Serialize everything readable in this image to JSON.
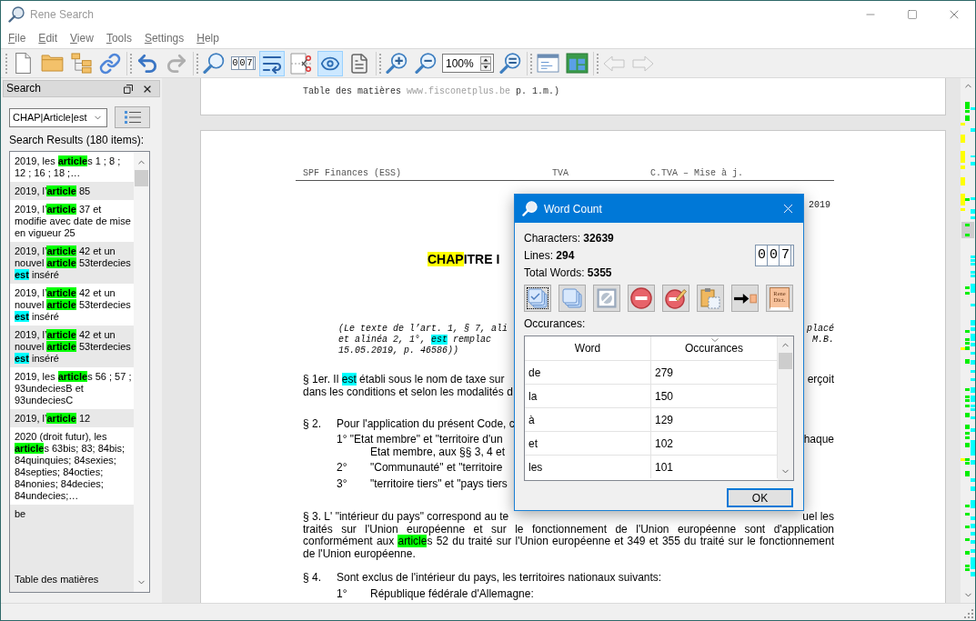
{
  "window": {
    "title": "Rene Search"
  },
  "menu": [
    {
      "label": "File"
    },
    {
      "label": "Edit"
    },
    {
      "label": "View"
    },
    {
      "label": "Tools"
    },
    {
      "label": "Settings"
    },
    {
      "label": "Help"
    }
  ],
  "toolbar": [
    [
      {
        "kind": "button",
        "on": false,
        "disabled": false
      },
      {
        "kind": "button",
        "on": false,
        "disabled": false
      },
      {
        "kind": "button",
        "on": false,
        "disabled": false
      },
      {
        "kind": "button",
        "on": false,
        "disabled": false
      }
    ],
    [
      {
        "kind": "button",
        "on": false,
        "disabled": false
      },
      {
        "kind": "button",
        "on": false,
        "disabled": true
      }
    ],
    [
      {
        "kind": "button",
        "on": false,
        "disabled": false
      },
      {
        "kind": "counter",
        "label": "007",
        "on": false,
        "disabled": false
      },
      {
        "kind": "button",
        "on": true,
        "disabled": false
      },
      {
        "kind": "button",
        "on": false,
        "disabled": false
      },
      {
        "kind": "button",
        "on": true,
        "disabled": false
      },
      {
        "kind": "button",
        "on": false,
        "disabled": false
      }
    ],
    [
      {
        "kind": "button",
        "on": false,
        "disabled": false
      },
      {
        "kind": "button",
        "on": false,
        "disabled": false
      },
      {
        "kind": "zoom",
        "value": "100%"
      },
      {
        "kind": "button",
        "on": false,
        "disabled": false
      }
    ],
    [
      {
        "kind": "button",
        "on": false,
        "disabled": false
      },
      {
        "kind": "button",
        "on": false,
        "disabled": false
      }
    ],
    [
      {
        "kind": "button",
        "on": false,
        "disabled": true
      },
      {
        "kind": "button",
        "on": false,
        "disabled": true
      }
    ]
  ],
  "search_panel": {
    "title": "Search",
    "query": "CHAP|Article|est",
    "results_label": "Search Results (180 items):",
    "results": [
      {
        "parts": [
          {
            "text": "2019, les "
          },
          {
            "text": "article",
            "color": "#00ff00"
          },
          {
            "text": "s 1 ; 8 ; 12 ; 16 ; 18 ;…"
          }
        ]
      },
      {
        "parts": [
          {
            "text": "2019, l’"
          },
          {
            "text": "article",
            "color": "#00ff00"
          },
          {
            "text": " 85"
          }
        ]
      },
      {
        "parts": [
          {
            "text": "2019, l’"
          },
          {
            "text": "article",
            "color": "#00ff00"
          },
          {
            "text": " 37 et modifie avec date de mise en vigueur 25"
          }
        ]
      },
      {
        "parts": [
          {
            "text": "2019, l’"
          },
          {
            "text": "article",
            "color": "#00ff00"
          },
          {
            "text": " 42 et un nouvel "
          },
          {
            "text": "article",
            "color": "#00ff00"
          },
          {
            "text": " 53terdecies "
          },
          {
            "text": "est",
            "color": "#00ffff"
          },
          {
            "text": " inséré"
          }
        ]
      },
      {
        "parts": [
          {
            "text": "2019, l’"
          },
          {
            "text": "article",
            "color": "#00ff00"
          },
          {
            "text": " 42 et un nouvel "
          },
          {
            "text": "article",
            "color": "#00ff00"
          },
          {
            "text": " 53terdecies "
          },
          {
            "text": "est",
            "color": "#00ffff"
          },
          {
            "text": " inséré"
          }
        ]
      },
      {
        "parts": [
          {
            "text": "2019, l’"
          },
          {
            "text": "article",
            "color": "#00ff00"
          },
          {
            "text": " 42 et un nouvel "
          },
          {
            "text": "article",
            "color": "#00ff00"
          },
          {
            "text": " 53terdecies "
          },
          {
            "text": "est",
            "color": "#00ffff"
          },
          {
            "text": " inséré"
          }
        ]
      },
      {
        "parts": [
          {
            "text": "2019, les "
          },
          {
            "text": "article",
            "color": "#00ff00"
          },
          {
            "text": "s 56 ; 57 ; 93undeciesB et 93undeciesC"
          }
        ]
      },
      {
        "parts": [
          {
            "text": "2019, l’"
          },
          {
            "text": "article",
            "color": "#00ff00"
          },
          {
            "text": " 12"
          }
        ]
      },
      {
        "parts": [
          {
            "text": "2020 (droit futur), les "
          },
          {
            "text": "article",
            "color": "#00ff00"
          },
          {
            "text": "s 63bis; 83; 84bis; 84quinquies; 84sexies; 84septies; 84octies; 84nonies; 84decies; 84undecies;…"
          }
        ]
      },
      {
        "parts": [
          {
            "text": "be"
          }
        ],
        "note": "Table des matières"
      }
    ]
  },
  "document": {
    "top_page": {
      "parts": [
        {
          "text": "Table des matières ",
          "muted": false
        },
        {
          "text": "www.fisconetplus.be",
          "muted": true
        },
        {
          "text": " p. 1.m.)",
          "muted": false
        }
      ]
    },
    "header": [
      "SPF Finances (ESS)",
      "TVA",
      "C.TVA – Mise à j."
    ],
    "date": "2019",
    "title": [
      {
        "text": "CHAP",
        "color": "#ffff00"
      },
      {
        "text": "ITRE I"
      }
    ],
    "note": [
      {
        "parts": [
          {
            "text": "(Le texte de l’art. 1, § 7, ali"
          }
        ],
        "right": "placé"
      },
      {
        "parts": [
          {
            "text": "et alinéa 2, 1°, "
          },
          {
            "text": "est",
            "color": "#00ffff"
          },
          {
            "text": " remplac"
          }
        ],
        "right": "M.B."
      },
      {
        "parts": [
          {
            "text": "15.05.2019, p. 46586))"
          }
        ]
      }
    ],
    "paragraphs": [
      {
        "lines": [
          {
            "kind": "plain",
            "parts": [
              {
                "text": "§ 1er. Il "
              },
              {
                "text": "est",
                "color": "#00ffff"
              },
              {
                "text": " établi sous le nom de taxe sur"
              }
            ],
            "right": "erçoit"
          },
          {
            "kind": "plain",
            "parts": [
              {
                "text": "dans les conditions et selon les modalités d"
              }
            ]
          }
        ]
      },
      {
        "lines": [
          {
            "kind": "numbered",
            "num": "§ 2.",
            "parts": [
              {
                "text": "Pour l'application du présent Code, c"
              }
            ]
          },
          {
            "kind": "indent",
            "parts": [
              {
                "text": "1° \"Etat membre\" et \"territoire d'un"
              }
            ],
            "right": "haque"
          },
          {
            "kind": "subindent",
            "parts": [
              {
                "text": "Etat membre, aux §§ 3, 4 et"
              }
            ]
          },
          {
            "kind": "subitem",
            "num": "2°",
            "parts": [
              {
                "text": "\"Communauté\" et \"territoire"
              }
            ]
          },
          {
            "kind": "subitem",
            "num": "3°",
            "parts": [
              {
                "text": "\"territoire tiers\" et \"pays tiers"
              }
            ]
          }
        ]
      },
      {
        "lines": [
          {
            "kind": "plain",
            "parts": [
              {
                "text": "§ 3. L' \"intérieur du pays\" correspond au te"
              }
            ],
            "right": "uel les"
          },
          {
            "kind": "justified",
            "parts": [
              {
                "text": "traités sur l'Union européenne et sur le fonctionnement de l'Union européenne sont d'application"
              }
            ]
          },
          {
            "kind": "justified",
            "parts": [
              {
                "text": "conformément aux "
              },
              {
                "text": "article",
                "color": "#00ff00"
              },
              {
                "text": "s 52 du traité sur l'Union européenne et 349 et 355 du traité sur le fonctionnement"
              }
            ]
          },
          {
            "kind": "plain",
            "parts": [
              {
                "text": "de l'Union européenne."
              }
            ]
          }
        ]
      },
      {
        "lines": [
          {
            "kind": "numbered",
            "num": "§ 4.",
            "parts": [
              {
                "text": "Sont exclus de l'intérieur du pays, les territoires nationaux suivants:"
              }
            ]
          },
          {
            "kind": "subitem",
            "num": "1°",
            "parts": [
              {
                "text": "République fédérale d'Allemagne:"
              }
            ]
          }
        ]
      }
    ]
  },
  "word_count": {
    "title": "Word Count",
    "stats": [
      "Characters: **32639**",
      "Lines: **294**",
      "Total Words: **5355**"
    ],
    "counter": "007",
    "tools": [
      {
        "kind": "select-all",
        "focused": true
      },
      {
        "kind": "stack",
        "focused": false
      },
      {
        "kind": "clear",
        "focused": false
      },
      {
        "kind": "remove",
        "focused": false
      },
      {
        "kind": "edit-remove",
        "focused": false
      },
      {
        "kind": "paste",
        "focused": false
      },
      {
        "kind": "export",
        "focused": false
      },
      {
        "kind": "dictionary",
        "label": "Rene Dict.",
        "focused": false
      }
    ],
    "list_label": "Occurances:",
    "columns": [
      {
        "label": "Word",
        "sorted": false
      },
      {
        "label": "Occurances",
        "sorted": true
      }
    ],
    "rows": [
      [
        "de",
        "279"
      ],
      [
        "la",
        "150"
      ],
      [
        "à",
        "129"
      ],
      [
        "et",
        "102"
      ],
      [
        "les",
        "101"
      ]
    ],
    "ok": {
      "label": "OK",
      "default": true
    }
  }
}
